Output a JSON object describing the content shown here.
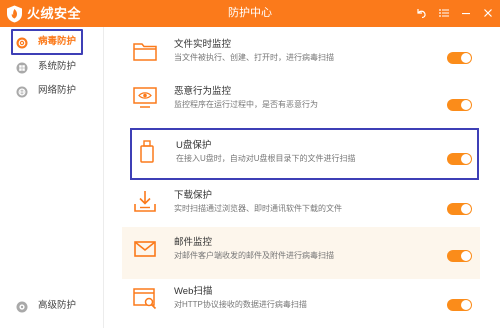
{
  "app": {
    "brand": "火绒安全",
    "window_title": "防护中心"
  },
  "window_controls": [
    "back-icon",
    "menu-icon",
    "minimize-icon",
    "close-icon"
  ],
  "sidebar": {
    "items": [
      {
        "label": "病毒防护",
        "icon": "virus-protect-icon",
        "active": true
      },
      {
        "label": "系统防护",
        "icon": "windows-icon",
        "active": false
      },
      {
        "label": "网络防护",
        "icon": "globe-icon",
        "active": false
      }
    ],
    "bottom_item": {
      "label": "高级防护",
      "icon": "advanced-icon"
    }
  },
  "protections": [
    {
      "name": "文件实时监控",
      "desc": "当文件被执行、创建、打开时，进行病毒扫描",
      "icon": "folder-icon",
      "enabled": true
    },
    {
      "name": "恶意行为监控",
      "desc": "监控程序在运行过程中，是否有恶意行为",
      "icon": "monitor-eye-icon",
      "enabled": true
    },
    {
      "name": "U盘保护",
      "desc": "在接入U盘时，自动对U盘根目录下的文件进行扫描",
      "icon": "usb-drive-icon",
      "enabled": true
    },
    {
      "name": "下载保护",
      "desc": "实时扫描通过浏览器、即时通讯软件下载的文件",
      "icon": "download-icon",
      "enabled": true
    },
    {
      "name": "邮件监控",
      "desc": "对邮件客户端收发的邮件及附件进行病毒扫描",
      "icon": "mail-icon",
      "enabled": true
    },
    {
      "name": "Web扫描",
      "desc": "对HTTP协议接收的数据进行病毒扫描",
      "icon": "web-scan-icon",
      "enabled": true
    }
  ],
  "colors": {
    "accent": "#fb7a1b",
    "toggle_on": "#fb8c1a",
    "highlight_box": "#3e3fb6"
  }
}
